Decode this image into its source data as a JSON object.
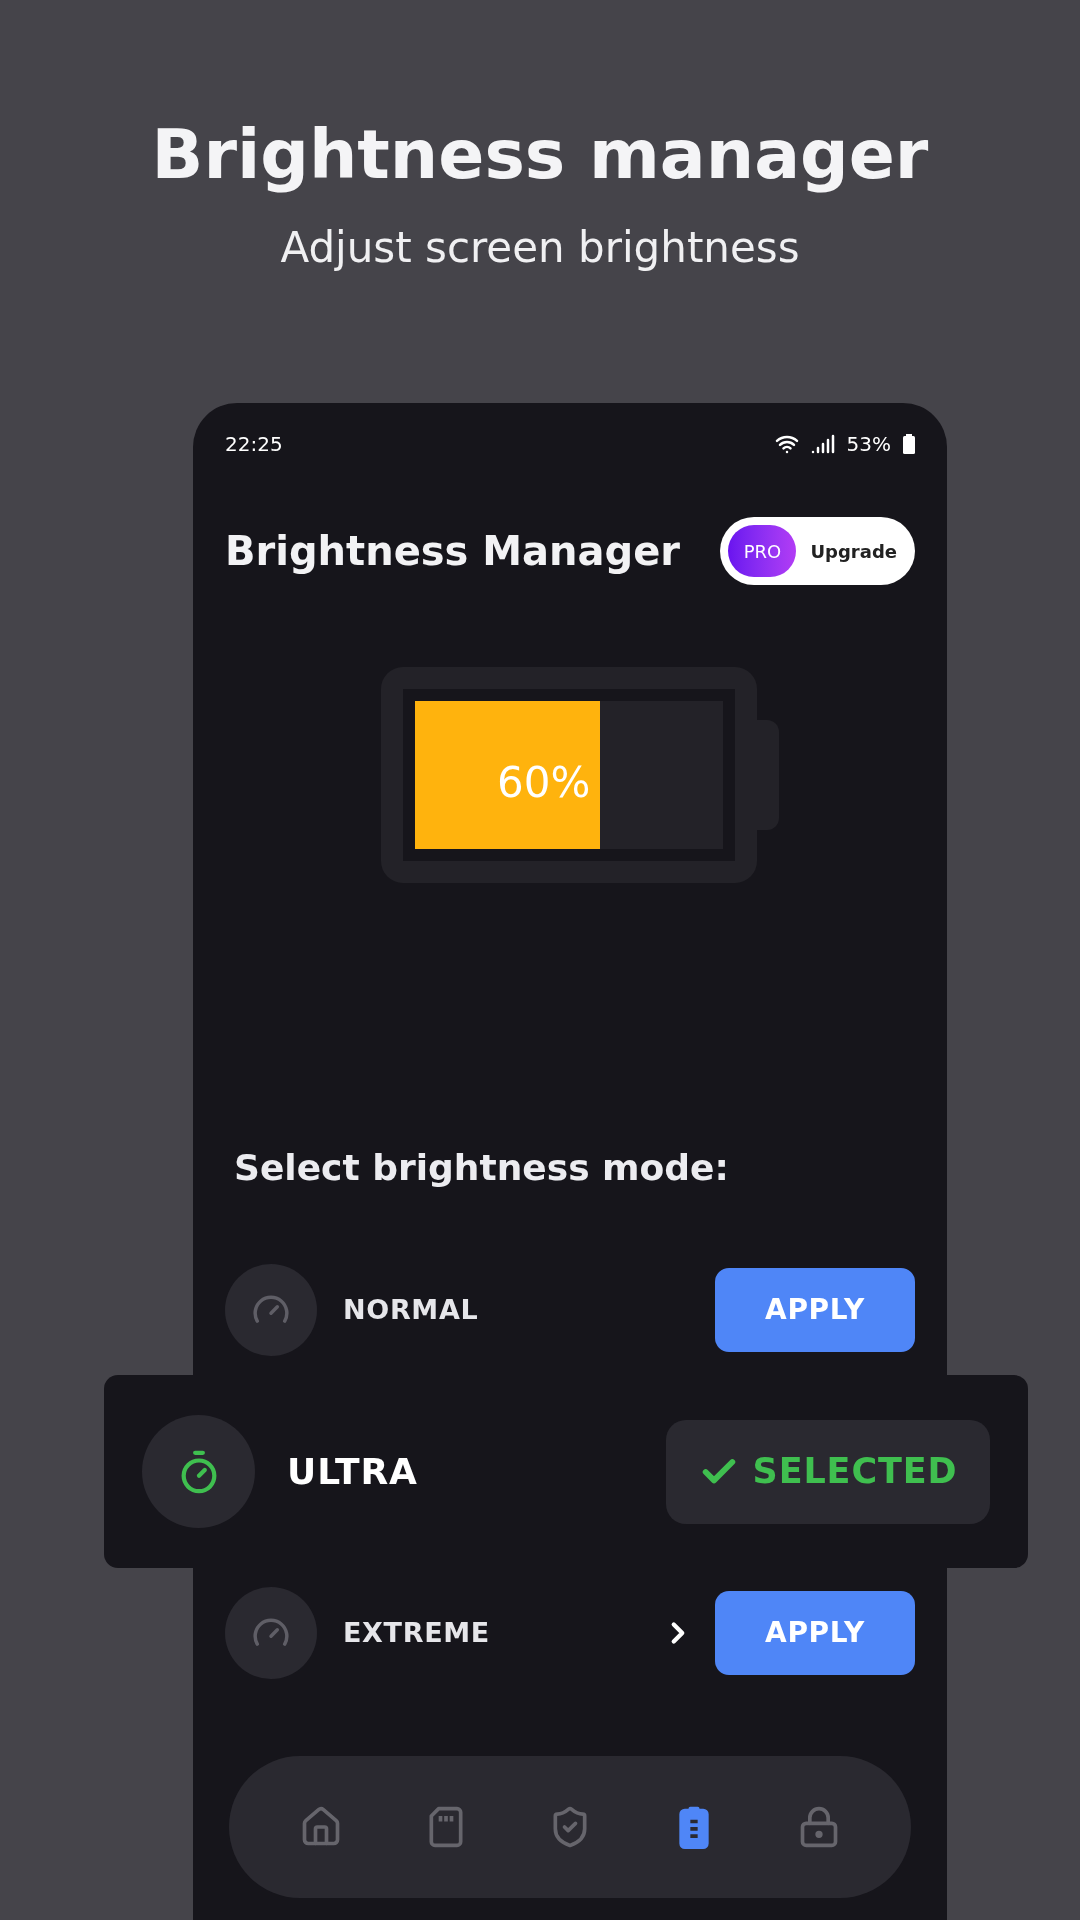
{
  "header": {
    "title": "Brightness manager",
    "subtitle": "Adjust screen brightness"
  },
  "status_bar": {
    "time": "22:25",
    "battery": "53%"
  },
  "app_bar": {
    "title": "Brightness Manager",
    "pro_badge": "PRO",
    "upgrade": "Upgrade"
  },
  "battery_meter": {
    "level": 0.6,
    "label": "60%"
  },
  "section_title": "Select brightness mode:",
  "modes": [
    {
      "kind": "gauge",
      "name": "NORMAL",
      "selected": false,
      "action": "APPLY",
      "chevron": false
    },
    {
      "kind": "timer",
      "name": "ULTRA",
      "selected": true,
      "action": "SELECTED",
      "chevron": false
    },
    {
      "kind": "speedometer",
      "name": "EXTREME",
      "selected": false,
      "action": "APPLY",
      "chevron": true
    }
  ],
  "nav": [
    {
      "kind": "home",
      "selected": false
    },
    {
      "kind": "sdcard",
      "selected": false
    },
    {
      "kind": "shield",
      "selected": false
    },
    {
      "kind": "battery",
      "selected": true
    },
    {
      "kind": "lock",
      "selected": false
    }
  ]
}
